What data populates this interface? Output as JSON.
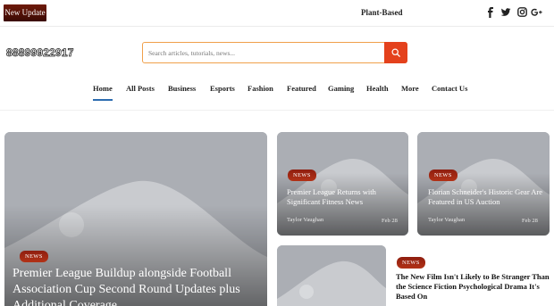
{
  "topbar": {
    "update_label": "New Update",
    "trending_text": "Plant-Based",
    "social": [
      {
        "icon": "facebook-icon",
        "glyph": "f"
      },
      {
        "icon": "twitter-icon",
        "glyph": "t"
      },
      {
        "icon": "instagram-icon",
        "glyph": "◎"
      },
      {
        "icon": "google-plus-icon",
        "glyph": "g+"
      }
    ]
  },
  "header": {
    "logo_text": "88899922917",
    "search_placeholder": "Search articles, tutorials, news..."
  },
  "nav": {
    "active": "Home",
    "items": [
      "Home",
      "All Posts",
      "Business",
      "Esports",
      "Fashion",
      "Featured",
      "Gaming",
      "Health",
      "More",
      "Contact Us"
    ]
  },
  "posts": {
    "featured": {
      "tag": "NEWS",
      "title": "Premier League Buildup alongside Football Association Cup Second Round Updates plus Additional Coverage"
    },
    "card1": {
      "tag": "NEWS",
      "title": "Premier League Returns with Significant Fitness News",
      "author": "Taylor Vaughan",
      "date": "Feb 28"
    },
    "card2": {
      "tag": "NEWS",
      "title": "Florian Schneider's Historic Gear Are Featured in US Auction",
      "author": "Taylor Vaughan",
      "date": "Feb 28"
    },
    "side": {
      "tag": "NEWS",
      "title": "The New Film Isn't Likely to Be Stranger Than the Science Fiction Psychological Drama It's Based On"
    }
  },
  "colors": {
    "accent": "#e4411c",
    "tag_bg": "#9c2412",
    "nav_active": "#2c6cb0",
    "placeholder_bg": "#a9acb2"
  }
}
